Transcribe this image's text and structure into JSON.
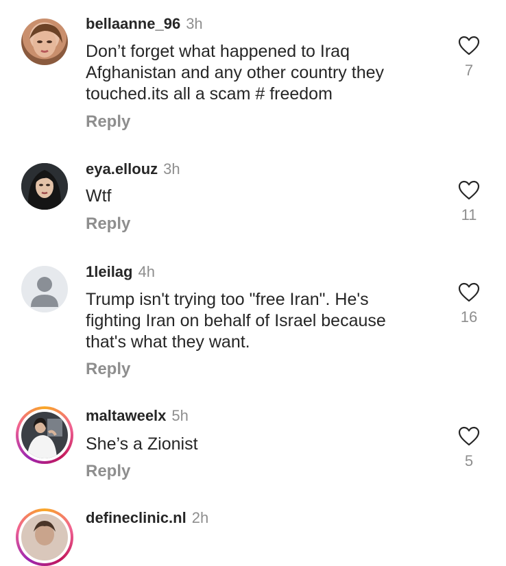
{
  "comments": [
    {
      "username": "bellaanne_96",
      "time": "3h",
      "text": "Don’t forget what happened to Iraq Afghanistan and any other country they touched.its all a scam # freedom",
      "reply": "Reply",
      "likes": "7",
      "avatar_icon": "user-photo-avatar"
    },
    {
      "username": "eya.ellouz",
      "time": "3h",
      "text": "Wtf",
      "reply": "Reply",
      "likes": "11",
      "avatar_icon": "user-photo-avatar"
    },
    {
      "username": "1leilag",
      "time": "4h",
      "text": "Trump isn't trying too \"free Iran\". He's fighting Iran on behalf of Israel because that's what they want.",
      "reply": "Reply",
      "likes": "16",
      "avatar_icon": "default-user-avatar"
    },
    {
      "username": "maltaweelx",
      "time": "5h",
      "text": "She’s a Zionist",
      "reply": "Reply",
      "likes": "5",
      "avatar_icon": "story-ring-avatar"
    },
    {
      "username": "defineclinic.nl",
      "time": "2h",
      "avatar_icon": "story-ring-avatar"
    }
  ],
  "colors": {
    "text": "#262626",
    "muted": "#8e8e8e",
    "story_ring": [
      "#f9a825",
      "#f06292",
      "#9c27b0"
    ]
  }
}
